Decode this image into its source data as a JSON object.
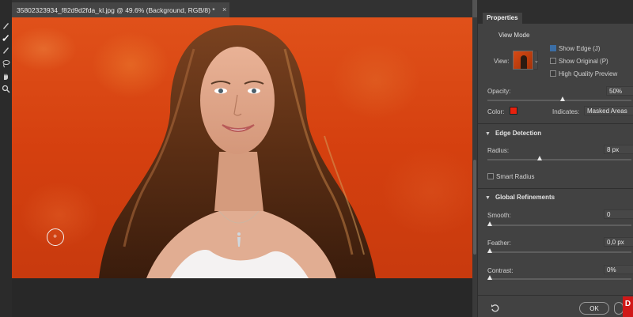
{
  "document": {
    "tab_title": "35802323934_f82d9d2fda_kl.jpg @ 49.6% (Background, RGB/8) *",
    "close_glyph": "×"
  },
  "toolbar": {
    "tools": [
      "quick-selection-brush-icon",
      "refine-edge-brush-icon",
      "brush-icon",
      "lasso-icon",
      "hand-icon",
      "zoom-icon"
    ]
  },
  "properties": {
    "tab_label": "Properties",
    "view_mode": {
      "heading": "View Mode",
      "view_label": "View:",
      "show_edge": {
        "label": "Show Edge (J)",
        "checked": true
      },
      "show_original": {
        "label": "Show Original (P)",
        "checked": false
      },
      "high_quality_preview": {
        "label": "High Quality Preview",
        "checked": false
      }
    },
    "opacity": {
      "label": "Opacity:",
      "value": "50%",
      "fraction": 0.5
    },
    "color": {
      "label": "Color:",
      "swatch": "#e8210d"
    },
    "indicates": {
      "label": "Indicates:",
      "value": "Masked Areas"
    },
    "edge_detection": {
      "heading": "Edge Detection",
      "radius": {
        "label": "Radius:",
        "value": "8 px",
        "fraction": 0.33
      },
      "smart_radius": {
        "label": "Smart Radius",
        "checked": false
      }
    },
    "global_refinements": {
      "heading": "Global Refinements",
      "smooth": {
        "label": "Smooth:",
        "value": "0",
        "fraction": 0
      },
      "feather": {
        "label": "Feather:",
        "value": "0,0 px",
        "fraction": 0
      },
      "contrast": {
        "label": "Contrast:",
        "value": "0%",
        "fraction": 0
      }
    },
    "ok_label": "OK"
  },
  "colors": {
    "accent_blue": "#3b6ea5",
    "overlay_red": "#d5400f"
  }
}
